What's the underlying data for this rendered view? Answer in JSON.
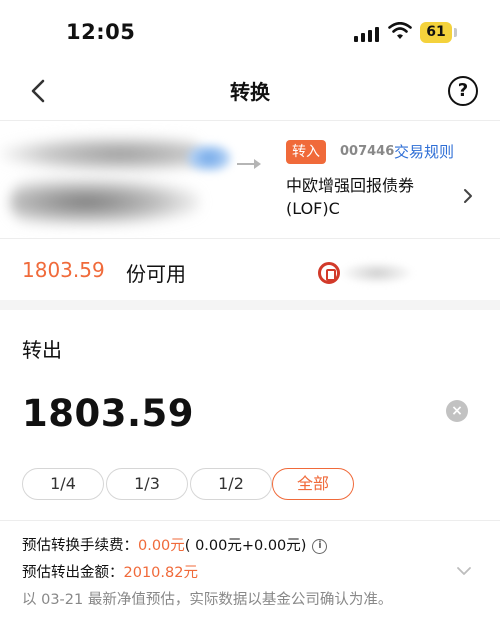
{
  "status_bar": {
    "time": "12:05",
    "battery": "61",
    "signal_icon": "cellular-signal-icon",
    "wifi_icon": "wifi-icon"
  },
  "nav": {
    "title": "转换",
    "back_icon": "chevron-left-icon",
    "help_label": "?"
  },
  "target_fund": {
    "badge": "转入",
    "code": "007446",
    "rules_link": "交易规则",
    "name": "中欧增强回报债券(LOF)C"
  },
  "available": {
    "amount": "1803.59",
    "unit_label": "份可用"
  },
  "transfer_out": {
    "label": "转出",
    "amount": "1803.59",
    "clear_label": "×"
  },
  "quick_select": [
    {
      "label": "1/4",
      "active": false
    },
    {
      "label": "1/3",
      "active": false
    },
    {
      "label": "1/2",
      "active": false
    },
    {
      "label": "全部",
      "active": true
    }
  ],
  "fee_info": {
    "fee_label": "预估转换手续费：",
    "fee_value": "0.00元",
    "fee_breakdown": "( 0.00元+0.00元)",
    "info_icon_label": "i",
    "amount_label": "预估转出金额：",
    "amount_value": "2010.82元",
    "note": "以 03-21 最新净值预估，实际数据以基金公司确认为准。"
  },
  "colors": {
    "accent": "#f06a3a",
    "link": "#2f6fd6",
    "muted": "#888888"
  }
}
